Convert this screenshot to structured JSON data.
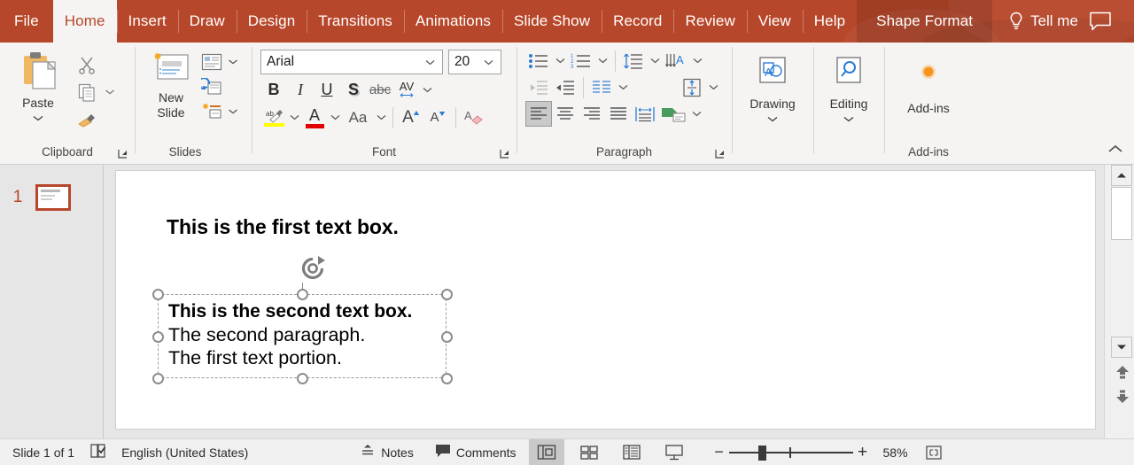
{
  "app": {
    "title": "PowerPoint",
    "accent_color": "#b7472a",
    "ribbon_bg": "#f5f4f3"
  },
  "tabs": [
    {
      "label": "File",
      "state": "normal",
      "name": "tab-file"
    },
    {
      "label": "Home",
      "state": "active",
      "name": "tab-home"
    },
    {
      "label": "Insert",
      "state": "normal",
      "name": "tab-insert"
    },
    {
      "label": "Draw",
      "state": "normal",
      "name": "tab-draw"
    },
    {
      "label": "Design",
      "state": "normal",
      "name": "tab-design"
    },
    {
      "label": "Transitions",
      "state": "normal",
      "name": "tab-transitions"
    },
    {
      "label": "Animations",
      "state": "normal",
      "name": "tab-animations"
    },
    {
      "label": "Slide Show",
      "state": "normal",
      "name": "tab-slide-show"
    },
    {
      "label": "Record",
      "state": "normal",
      "name": "tab-record"
    },
    {
      "label": "Review",
      "state": "normal",
      "name": "tab-review"
    },
    {
      "label": "View",
      "state": "normal",
      "name": "tab-view"
    },
    {
      "label": "Help",
      "state": "normal",
      "name": "tab-help"
    },
    {
      "label": "Shape Format",
      "state": "contextual",
      "name": "tab-shape-format"
    }
  ],
  "tellme": {
    "label": "Tell me",
    "icon": "lightbulb-icon"
  },
  "comments_button": {
    "icon": "comment-icon"
  },
  "ribbon": {
    "groups": [
      {
        "label": "Clipboard",
        "has_dialog_launcher": true
      },
      {
        "label": "Slides",
        "has_dialog_launcher": false
      },
      {
        "label": "Font",
        "has_dialog_launcher": true
      },
      {
        "label": "Paragraph",
        "has_dialog_launcher": true
      },
      {
        "label": "Add-ins",
        "has_dialog_launcher": false
      }
    ],
    "clipboard": {
      "paste_label": "Paste",
      "paste_icon": "paste-icon",
      "cut_icon": "scissors-icon",
      "copy_icon": "copy-icon",
      "format_painter_icon": "format-painter-icon"
    },
    "slides": {
      "new_slide_label": "New Slide",
      "new_slide_icon": "new-slide-icon",
      "layout_icon": "slide-layout-icon",
      "reset_icon": "reset-slide-icon",
      "section_icon": "section-icon"
    },
    "font": {
      "font_name": "Arial",
      "font_size": "20",
      "bold_label": "B",
      "italic_label": "I",
      "underline_label": "U",
      "shadow_label": "S",
      "strikethrough_label": "abc",
      "char_spacing_label": "AV",
      "change_case_label": "Aa",
      "text_highlight_icon": "text-highlight-icon",
      "font_color_icon": "font-color-icon",
      "grow_font_label": "A",
      "shrink_font_label": "A",
      "clear_formatting_icon": "clear-formatting-icon"
    },
    "paragraph": {
      "bullets_icon": "bullets-icon",
      "numbering_icon": "numbering-icon",
      "line_spacing_icon": "line-spacing-icon",
      "text_direction_icon": "text-direction-icon",
      "decrease_indent_icon": "decrease-indent-icon",
      "increase_indent_icon": "increase-indent-icon",
      "columns_icon": "columns-icon",
      "align_text_icon": "align-text-vertical-icon",
      "align_left_icon": "align-left-icon",
      "align_center_icon": "align-center-icon",
      "align_right_icon": "align-right-icon",
      "justify_icon": "justify-icon",
      "distribute_icon": "distribute-icon",
      "convert_smartart_icon": "convert-to-smartart-icon",
      "active_alignment": "align-left"
    },
    "drawing": {
      "label": "Drawing",
      "icon": "drawing-icon"
    },
    "editing": {
      "label": "Editing",
      "icon": "editing-search-icon"
    },
    "addins": {
      "label": "Add-ins",
      "icon": "addins-dot-icon"
    },
    "collapse_icon": "collapse-ribbon-icon"
  },
  "thumbnails": [
    {
      "number": "1",
      "selected": true
    }
  ],
  "slide": {
    "textbox1": {
      "text": "This is the first text box.",
      "bold": true,
      "selected": false
    },
    "textbox2": {
      "selected": true,
      "lines": [
        {
          "text": "This is the second text box.",
          "bold": true
        },
        {
          "text": "The second paragraph.",
          "bold": false
        },
        {
          "text": "The first text portion.",
          "bold": false
        }
      ]
    },
    "rotation_handle_icon": "rotate-handle-icon"
  },
  "scrollbar": {
    "up_icon": "scroll-up-icon",
    "down_icon": "scroll-down-icon",
    "prev_slide_icon": "previous-slide-icon",
    "next_slide_icon": "next-slide-icon"
  },
  "status": {
    "slide_counter": "Slide 1 of 1",
    "accessibility_icon": "accessibility-check-icon",
    "language": "English (United States)",
    "notes_label": "Notes",
    "notes_icon": "notes-icon",
    "comments_label": "Comments",
    "comments_icon": "comments-icon",
    "views": [
      {
        "name": "normal-view",
        "icon": "normal-view-icon",
        "active": true
      },
      {
        "name": "slide-sorter-view",
        "icon": "slide-sorter-icon",
        "active": false
      },
      {
        "name": "reading-view",
        "icon": "reading-view-icon",
        "active": false
      },
      {
        "name": "slide-show-view",
        "icon": "slide-show-icon",
        "active": false
      }
    ],
    "zoom_out_label": "−",
    "zoom_in_label": "+",
    "zoom_value": "58%",
    "fit_slide_icon": "fit-to-window-icon"
  }
}
